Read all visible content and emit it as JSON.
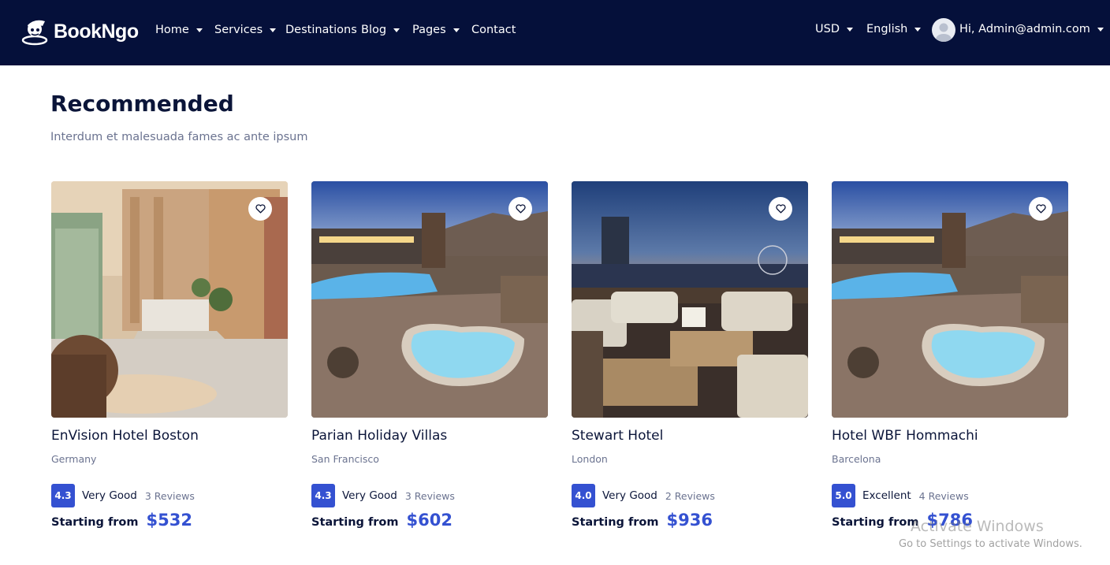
{
  "brand": {
    "name": "BookNgo"
  },
  "nav": {
    "items": [
      {
        "label": "Home",
        "has_dropdown": true
      },
      {
        "label": "Services",
        "has_dropdown": true
      },
      {
        "label": "Destinations",
        "has_dropdown": false
      },
      {
        "label": "Blog",
        "has_dropdown": true
      },
      {
        "label": "Pages",
        "has_dropdown": true
      },
      {
        "label": "Contact",
        "has_dropdown": false
      }
    ],
    "currency": "USD",
    "language": "English",
    "user_greeting": "Hi, Admin@admin.com"
  },
  "section": {
    "title": "Recommended",
    "subtitle": "Interdum et malesuada fames ac ante ipsum"
  },
  "hotels": [
    {
      "name": "EnVision Hotel Boston",
      "location": "Germany",
      "score": "4.3",
      "rating_label": "Very Good",
      "reviews": "3 Reviews",
      "price_label": "Starting from",
      "price": "$532",
      "image": "hotel-lobby"
    },
    {
      "name": "Parian Holiday Villas",
      "location": "San Francisco",
      "score": "4.3",
      "rating_label": "Very Good",
      "reviews": "3 Reviews",
      "price_label": "Starting from",
      "price": "$602",
      "image": "rooftop-pool"
    },
    {
      "name": "Stewart Hotel",
      "location": "London",
      "score": "4.0",
      "rating_label": "Very Good",
      "reviews": "2 Reviews",
      "price_label": "Starting from",
      "price": "$936",
      "image": "city-terrace-night"
    },
    {
      "name": "Hotel WBF Hommachi",
      "location": "Barcelona",
      "score": "5.0",
      "rating_label": "Excellent",
      "reviews": "4 Reviews",
      "price_label": "Starting from",
      "price": "$786",
      "image": "rooftop-pool"
    }
  ],
  "watermark": {
    "title": "Activate Windows",
    "subtitle": "Go to Settings to activate Windows."
  },
  "colors": {
    "navbar_bg": "#05103a",
    "accent": "#3451d1",
    "heading": "#0b1539",
    "muted": "#6b7390"
  }
}
